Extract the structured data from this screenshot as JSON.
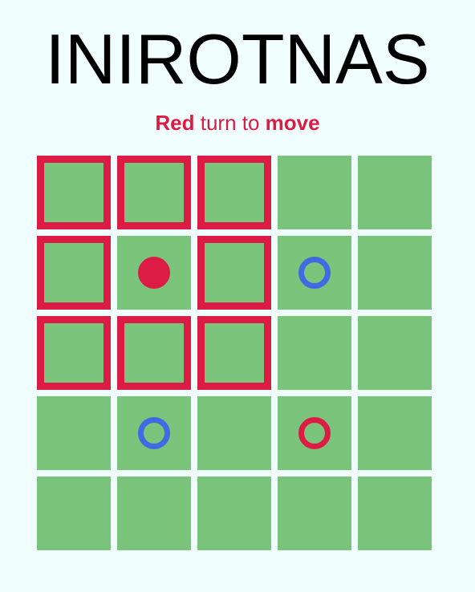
{
  "title": "INIROTNAS",
  "status": {
    "player": "Red",
    "middle": " turn to ",
    "action": "move"
  },
  "colors": {
    "background": "#f0fffe",
    "cell": "#7bc47c",
    "red": "#dc1c45",
    "blue": "#4169e1",
    "text": "#000000"
  },
  "board": {
    "rows": 5,
    "cols": 5,
    "highlighted": [
      [
        0,
        0
      ],
      [
        0,
        1
      ],
      [
        0,
        2
      ],
      [
        1,
        0
      ],
      [
        1,
        2
      ],
      [
        2,
        0
      ],
      [
        2,
        1
      ],
      [
        2,
        2
      ]
    ],
    "highlight_color": "red",
    "pieces": [
      {
        "row": 1,
        "col": 1,
        "color": "red",
        "style": "filled"
      },
      {
        "row": 1,
        "col": 3,
        "color": "blue",
        "style": "ring"
      },
      {
        "row": 3,
        "col": 1,
        "color": "blue",
        "style": "ring"
      },
      {
        "row": 3,
        "col": 3,
        "color": "red",
        "style": "ring"
      }
    ]
  }
}
